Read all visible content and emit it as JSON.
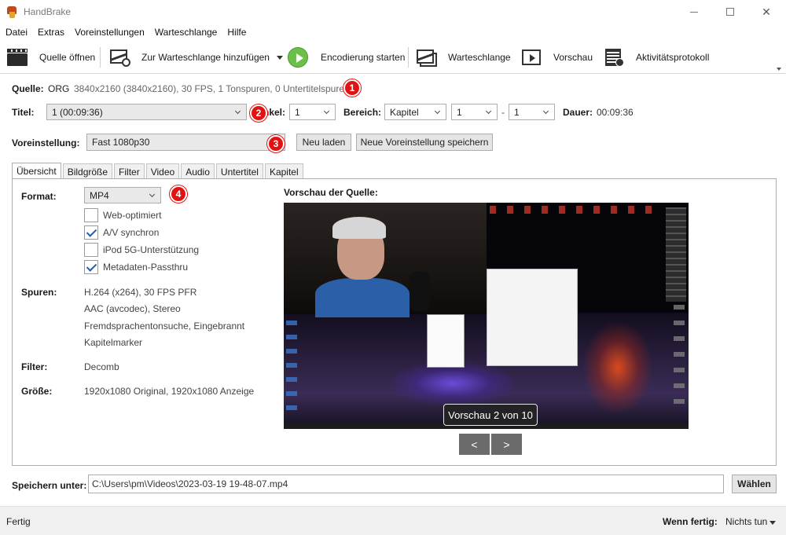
{
  "window": {
    "title": "HandBrake"
  },
  "menu": [
    "Datei",
    "Extras",
    "Voreinstellungen",
    "Warteschlange",
    "Hilfe"
  ],
  "toolbar": {
    "open_source": "Quelle öffnen",
    "add_queue": "Zur Warteschlange hinzufügen",
    "start_encode": "Encodierung starten",
    "queue": "Warteschlange",
    "preview": "Vorschau",
    "activity_log": "Aktivitätsprotokoll"
  },
  "source": {
    "label": "Quelle:",
    "name": "ORG",
    "info": "3840x2160 (3840x2160), 30 FPS, 1 Tonspuren, 0 Untertitelspuren"
  },
  "title_row": {
    "title_label": "Titel:",
    "title_value": "1  (00:09:36)",
    "angle_label": "Winkel:",
    "angle_visible": "nkel:",
    "angle_value": "1",
    "range_label": "Bereich:",
    "range_type": "Kapitel",
    "range_start": "1",
    "range_sep": "-",
    "range_end": "1",
    "duration_label": "Dauer:",
    "duration_value": "00:09:36"
  },
  "preset": {
    "label": "Voreinstellung:",
    "value": "Fast 1080p30",
    "reload": "Neu laden",
    "save_new": "Neue Voreinstellung speichern"
  },
  "badges": [
    "1",
    "2",
    "3",
    "4"
  ],
  "tabs": [
    "Übersicht",
    "Bildgröße",
    "Filter",
    "Video",
    "Audio",
    "Untertitel",
    "Kapitel"
  ],
  "summary": {
    "format_label": "Format:",
    "format_value": "MP4",
    "checkboxes": [
      {
        "label": "Web-optimiert",
        "checked": false
      },
      {
        "label": "A/V synchron",
        "checked": true
      },
      {
        "label": "iPod 5G-Unterstützung",
        "checked": false
      },
      {
        "label": "Metadaten-Passthru",
        "checked": true
      }
    ],
    "tracks_label": "Spuren:",
    "tracks": [
      "H.264 (x264), 30 FPS PFR",
      "AAC (avcodec), Stereo",
      "Fremdsprachentonsuche, Eingebrannt",
      "Kapitelmarker"
    ],
    "filter_label": "Filter:",
    "filter_value": "Decomb",
    "size_label": "Größe:",
    "size_value": "1920x1080 Original, 1920x1080 Anzeige",
    "preview_label": "Vorschau der Quelle:",
    "preview_caption": "Vorschau 2 von 10",
    "prev": "<",
    "next": ">"
  },
  "save": {
    "label": "Speichern unter:",
    "path": "C:\\Users\\pm\\Videos\\2023-03-19 19-48-07.mp4",
    "browse": "Wählen"
  },
  "status": {
    "state": "Fertig",
    "when_done_label": "Wenn fertig:",
    "when_done_value": "Nichts tun"
  },
  "colors": {
    "badge": "#e31212",
    "play": "#6cc04a",
    "checkmark": "#1c5eb8"
  }
}
